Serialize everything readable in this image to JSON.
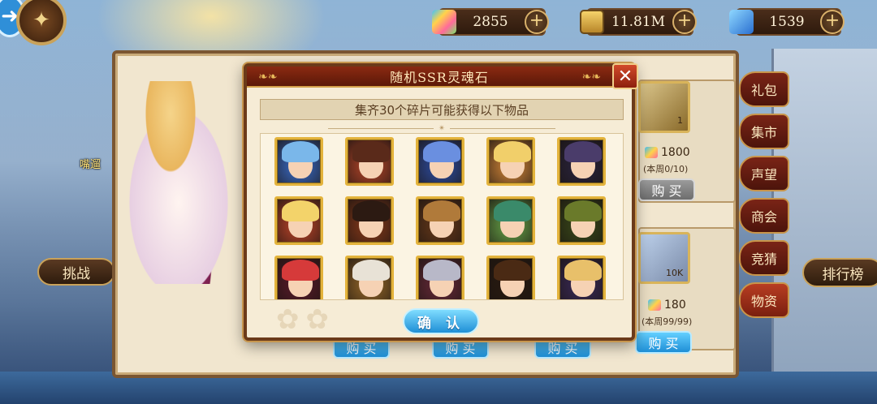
{
  "resources": [
    {
      "icon": "rainbow-gem-icon",
      "value": "2855",
      "color": "#3ec1ff"
    },
    {
      "icon": "gold-bar-icon",
      "value": "11.81M",
      "color": "#e3a93a"
    },
    {
      "icon": "blue-crystal-icon",
      "value": "1539",
      "color": "#3a8fe0"
    }
  ],
  "side_menu": [
    "礼包",
    "集市",
    "声望",
    "商会",
    "竞猜",
    "物资"
  ],
  "left_labels": {
    "challenge": "挑战",
    "bird": "嘴遛"
  },
  "rank_label": "排行榜",
  "shop": {
    "item1": {
      "count": "1",
      "price": "1800",
      "limit": "(本周0/10)",
      "buy": "购 买"
    },
    "item2": {
      "count": "10K",
      "price": "180",
      "limit": "(本周99/99)",
      "buy": "购 买"
    },
    "bottom_buys": [
      "购 买",
      "购 买",
      "购 买",
      "购 买"
    ]
  },
  "modal": {
    "title": "随机SSR灵魂石",
    "subtitle": "集齐30个碎片可能获得以下物品",
    "confirm": "确 认",
    "heroes": [
      {
        "name": "hero-1",
        "hair": "#7ab7ea",
        "bg": "#3b6fd0"
      },
      {
        "name": "hero-2",
        "hair": "#5a2a1a",
        "bg": "#b8462a"
      },
      {
        "name": "hero-3",
        "hair": "#6a8fe0",
        "bg": "#2e4fa8"
      },
      {
        "name": "hero-4",
        "hair": "#f1cf6a",
        "bg": "#d98a3a"
      },
      {
        "name": "hero-5",
        "hair": "#4a3c6a",
        "bg": "#2a2440"
      },
      {
        "name": "hero-6",
        "hair": "#f3d36a",
        "bg": "#c2462a"
      },
      {
        "name": "hero-7",
        "hair": "#2c1a12",
        "bg": "#8a3a1a"
      },
      {
        "name": "hero-8",
        "hair": "#b07a3a",
        "bg": "#6a3a1a"
      },
      {
        "name": "hero-9",
        "hair": "#3a8a6a",
        "bg": "#6aa84a"
      },
      {
        "name": "hero-10",
        "hair": "#6a7a2a",
        "bg": "#3a4a1a"
      },
      {
        "name": "hero-11",
        "hair": "#d63a3a",
        "bg": "#5a1a2a"
      },
      {
        "name": "hero-12",
        "hair": "#e8e2d6",
        "bg": "#9a6a2a"
      },
      {
        "name": "hero-13",
        "hair": "#b8b8c8",
        "bg": "#6a2a3a"
      },
      {
        "name": "hero-14",
        "hair": "#4a2a14",
        "bg": "#2a1a10"
      },
      {
        "name": "hero-15",
        "hair": "#e8c06a",
        "bg": "#3a2a5a"
      }
    ]
  }
}
